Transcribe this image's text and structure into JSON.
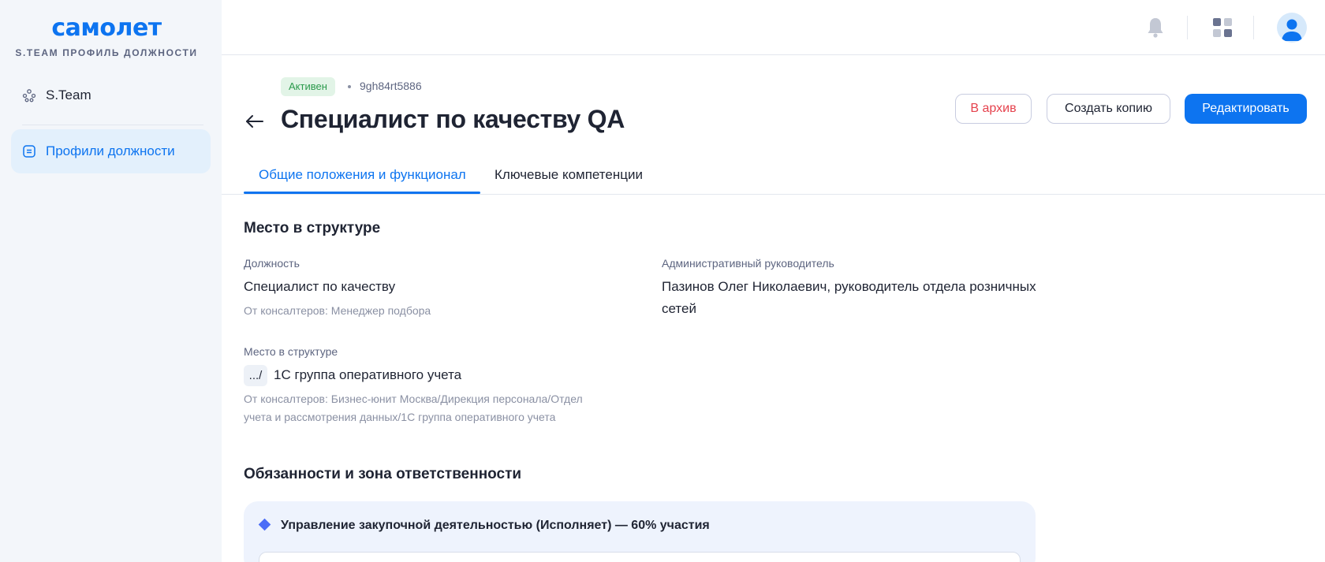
{
  "brand": {
    "logo": "самолет",
    "subtitle": "S.TEAM ПРОФИЛЬ ДОЛЖНОСТИ"
  },
  "sidebar": {
    "items": [
      {
        "label": "S.Team",
        "icon": "team-icon",
        "active": false
      },
      {
        "label": "Профили должности",
        "icon": "document-list-icon",
        "active": true
      }
    ]
  },
  "topbar": {
    "icons": [
      "bell-icon",
      "apps-grid-icon",
      "avatar"
    ]
  },
  "header": {
    "status": "Активен",
    "id": "9gh84rt5886",
    "title": "Специалист по качеству QA",
    "buttons": {
      "archive": "В архив",
      "copy": "Создать копию",
      "edit": "Редактировать"
    }
  },
  "tabs": [
    {
      "label": "Общие положения и функционал",
      "active": true
    },
    {
      "label": "Ключевые компетенции",
      "active": false
    }
  ],
  "structure": {
    "title": "Место в структуре",
    "position": {
      "label": "Должность",
      "value": "Специалист по качеству",
      "hint": "От консалтеров: Менеджер подбора"
    },
    "manager": {
      "label": "Административный руководитель",
      "value_line1": "Пазинов Олег Николаевич, руководитель отдела розничных",
      "value_line2": "сетей"
    },
    "place": {
      "label": "Место в структуре",
      "path_prefix": ".../",
      "value": "1С группа оперативного учета",
      "hint_line1": "От консалтеров: Бизнес-юнит Москва/Дирекция персонала/Отдел",
      "hint_line2": "учета и рассмотрения данных/1С группа оперативного учета"
    }
  },
  "responsibilities": {
    "title": "Обязанности и зона ответственности",
    "items": [
      {
        "title": "Управление закупочной деятельностью (Исполняет) — 60% участия"
      }
    ]
  },
  "colors": {
    "accent": "#0d74f0",
    "danger": "#e5424d",
    "success_bg": "#e2f4e7",
    "success_text": "#2b9a4c",
    "sidebar_bg": "#f3f6fa"
  }
}
